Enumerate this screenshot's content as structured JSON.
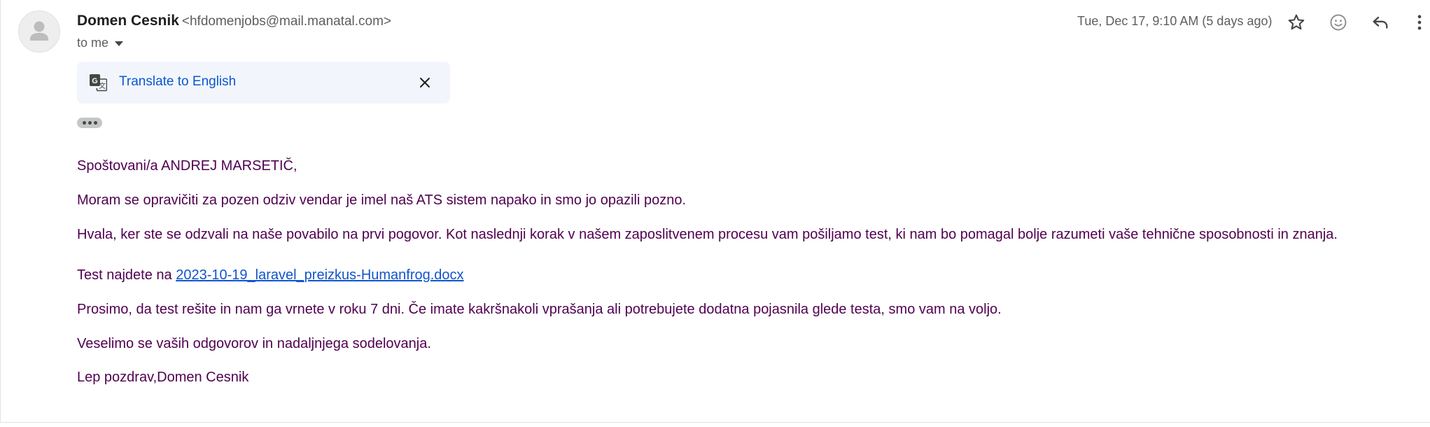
{
  "sender": {
    "name": "Domen Cesnik",
    "email": "<hfdomenjobs@mail.manatal.com>",
    "recipient_label": "to me",
    "avatar_icon": "person-icon"
  },
  "header": {
    "date": "Tue, Dec 17, 9:10 AM (5 days ago)",
    "icons": [
      "star-icon",
      "emoji-icon",
      "reply-icon",
      "more-vert-icon"
    ]
  },
  "translate": {
    "icon": "translate-icon",
    "label": "Translate to English",
    "close_icon": "close-icon"
  },
  "trimmed_content_icon": "more-horiz-icon",
  "body": {
    "greeting": "Spoštovani/a ANDREJ MARSETIČ,",
    "apology": "Moram se opravičiti za pozen odziv vendar je imel naš ATS sistem napako in smo jo opazili pozno.",
    "thanks": "Hvala, ker ste se odzvali na naše povabilo na prvi pogovor. Kot naslednji korak v našem zaposlitvenem procesu vam pošiljamo test, ki nam bo pomagal bolje razumeti vaše tehnične sposobnosti in znanja.",
    "test_prefix": "Test najdete na ",
    "test_link": "2023-10-19_laravel_preizkus-Humanfrog.docx",
    "deadline": "Prosimo, da test rešite in nam ga vrnete v roku 7 dni. Če imate kakršnakoli vprašanja ali potrebujete dodatna pojasnila glede testa, smo vam na voljo.",
    "closing": "Veselimo se vaših odgovorov in nadaljnjega sodelovanja.",
    "signature": "Lep pozdrav,Domen Cesnik"
  },
  "colors": {
    "body_text": "#500050",
    "link": "#1155cc",
    "translate_link": "#0b57d0",
    "translate_bg": "#f2f6fc"
  }
}
